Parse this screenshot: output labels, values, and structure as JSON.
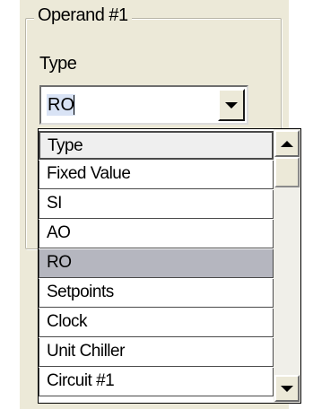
{
  "groupbox": {
    "title": "Operand #1"
  },
  "type_label": "Type",
  "combo": {
    "value": "RO"
  },
  "dropdown": {
    "items": [
      {
        "label": "Type",
        "header": true
      },
      {
        "label": "Fixed Value"
      },
      {
        "label": "SI"
      },
      {
        "label": "AO"
      },
      {
        "label": "RO",
        "selected": true
      },
      {
        "label": "Setpoints"
      },
      {
        "label": "Clock"
      },
      {
        "label": "Unit Chiller"
      },
      {
        "label": "Circuit #1"
      }
    ]
  },
  "icons": {
    "combo_button": "chevron-down-icon",
    "scroll_up": "scroll-up-arrow-icon",
    "scroll_down": "scroll-down-arrow-icon"
  }
}
